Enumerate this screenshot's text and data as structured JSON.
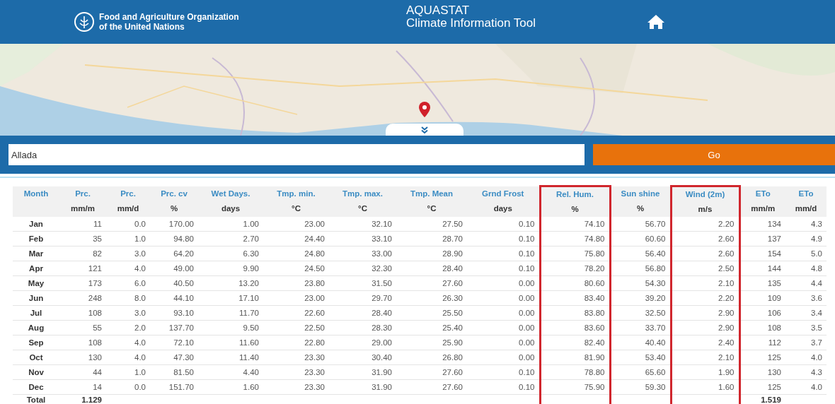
{
  "header": {
    "org_line1": "Food and Agriculture Organization",
    "org_line2": "of the United Nations",
    "app_line1": "AQUASTAT",
    "app_line2": "Climate Information Tool"
  },
  "search": {
    "value": "Allada",
    "button": "Go"
  },
  "table": {
    "columns": [
      {
        "title": "Month",
        "highlighted": false
      },
      {
        "title": "Prc.",
        "unit": "mm/m",
        "highlighted": false
      },
      {
        "title": "Prc.",
        "unit": "mm/d",
        "highlighted": false
      },
      {
        "title": "Prc. cv",
        "unit": "%",
        "highlighted": false
      },
      {
        "title": "Wet Days.",
        "unit": "days",
        "highlighted": false
      },
      {
        "title": "Tmp. min.",
        "unit": "°C",
        "highlighted": false
      },
      {
        "title": "Tmp. max.",
        "unit": "°C",
        "highlighted": false
      },
      {
        "title": "Tmp. Mean",
        "unit": "°C",
        "highlighted": false
      },
      {
        "title": "Grnd Frost",
        "unit": "days",
        "highlighted": false
      },
      {
        "title": "Rel. Hum.",
        "unit": "%",
        "highlighted": true
      },
      {
        "title": "Sun shine",
        "unit": "%",
        "highlighted": false
      },
      {
        "title": "Wind (2m)",
        "unit": "m/s",
        "highlighted": true
      },
      {
        "title": "ETo",
        "unit": "mm/m",
        "highlighted": false
      },
      {
        "title": "ETo",
        "unit": "mm/d",
        "highlighted": false
      }
    ],
    "rows": [
      {
        "month": "Jan",
        "values": [
          "11",
          "0.0",
          "170.00",
          "1.00",
          "23.00",
          "32.10",
          "27.50",
          "0.10",
          "74.10",
          "56.70",
          "2.20",
          "134",
          "4.3"
        ]
      },
      {
        "month": "Feb",
        "values": [
          "35",
          "1.0",
          "94.80",
          "2.70",
          "24.40",
          "33.10",
          "28.70",
          "0.10",
          "74.80",
          "60.60",
          "2.60",
          "137",
          "4.9"
        ]
      },
      {
        "month": "Mar",
        "values": [
          "82",
          "3.0",
          "64.20",
          "6.30",
          "24.80",
          "33.00",
          "28.90",
          "0.10",
          "75.80",
          "56.40",
          "2.60",
          "154",
          "5.0"
        ]
      },
      {
        "month": "Apr",
        "values": [
          "121",
          "4.0",
          "49.00",
          "9.90",
          "24.50",
          "32.30",
          "28.40",
          "0.10",
          "78.20",
          "56.80",
          "2.50",
          "144",
          "4.8"
        ]
      },
      {
        "month": "May",
        "values": [
          "173",
          "6.0",
          "40.50",
          "13.20",
          "23.80",
          "31.50",
          "27.60",
          "0.00",
          "80.60",
          "54.30",
          "2.10",
          "135",
          "4.4"
        ]
      },
      {
        "month": "Jun",
        "values": [
          "248",
          "8.0",
          "44.10",
          "17.10",
          "23.00",
          "29.70",
          "26.30",
          "0.00",
          "83.40",
          "39.20",
          "2.20",
          "109",
          "3.6"
        ]
      },
      {
        "month": "Jul",
        "values": [
          "108",
          "3.0",
          "93.10",
          "11.70",
          "22.60",
          "28.40",
          "25.50",
          "0.00",
          "83.80",
          "32.50",
          "2.90",
          "106",
          "3.4"
        ]
      },
      {
        "month": "Aug",
        "values": [
          "55",
          "2.0",
          "137.70",
          "9.50",
          "22.50",
          "28.30",
          "25.40",
          "0.00",
          "83.60",
          "33.70",
          "2.90",
          "108",
          "3.5"
        ]
      },
      {
        "month": "Sep",
        "values": [
          "108",
          "4.0",
          "72.10",
          "11.60",
          "22.80",
          "29.00",
          "25.90",
          "0.00",
          "82.40",
          "40.40",
          "2.40",
          "112",
          "3.7"
        ]
      },
      {
        "month": "Oct",
        "values": [
          "130",
          "4.0",
          "47.30",
          "11.40",
          "23.30",
          "30.40",
          "26.80",
          "0.00",
          "81.90",
          "53.40",
          "2.10",
          "125",
          "4.0"
        ]
      },
      {
        "month": "Nov",
        "values": [
          "44",
          "1.0",
          "81.50",
          "4.40",
          "23.30",
          "31.90",
          "27.60",
          "0.10",
          "78.80",
          "65.60",
          "1.90",
          "130",
          "4.3"
        ]
      },
      {
        "month": "Dec",
        "values": [
          "14",
          "0.0",
          "151.70",
          "1.60",
          "23.30",
          "31.90",
          "27.60",
          "0.10",
          "75.90",
          "59.30",
          "1.60",
          "125",
          "4.0"
        ]
      }
    ],
    "total": {
      "label": "Total",
      "prc_mm_m": "1.129",
      "eto_mm_m": "1.519"
    }
  }
}
